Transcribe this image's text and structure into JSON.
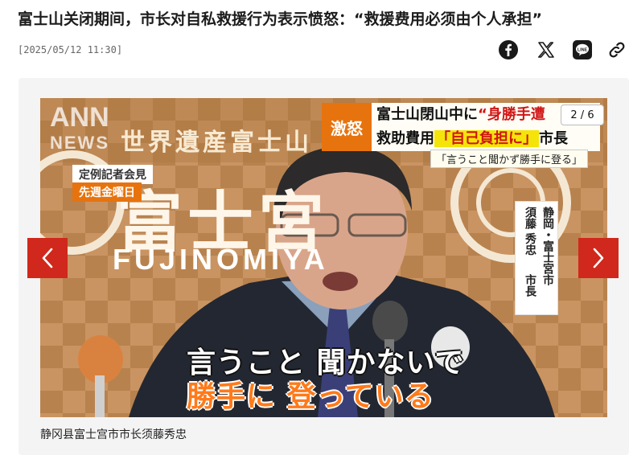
{
  "article": {
    "headline": "富士山关闭期间，市长对自私救援行为表示愤怒：“救援费用必须由个人承担”",
    "timestamp": "[2025/05/12 11:30]"
  },
  "share": {
    "icons": [
      "facebook-icon",
      "x-icon",
      "line-icon",
      "link-icon"
    ]
  },
  "gallery": {
    "counter": "2 / 6",
    "caption": "静冈县富士宫市市长须藤秀忠",
    "prev_icon": "chevron-left-icon",
    "next_icon": "chevron-right-icon",
    "accent": "#d0281c"
  },
  "video": {
    "logo_top": "ANN",
    "logo_bottom": "NEWS",
    "background_title": "世界遺産富士山",
    "background_big": "富士宮",
    "background_fuji": "FUJINOMIYA",
    "tag_top": "定例記者会見",
    "tag_bottom": "先週金曜日",
    "headline_badge": "激怒",
    "headline_line1_a": "富士山閉山中に",
    "headline_line1_b": "“身勝手遭",
    "headline_line2_a": "救助費用",
    "headline_line2_b": "「自己負担に」",
    "headline_line2_c": "市長",
    "quote": "「言うこと聞かず勝手に登る」",
    "name_pref": "静岡・富士宮市",
    "name_person": "須藤 秀忠",
    "name_title": "市長",
    "subtitle_line1": "言うこと 聞かないで",
    "subtitle_line2": "勝手に 登っている"
  }
}
